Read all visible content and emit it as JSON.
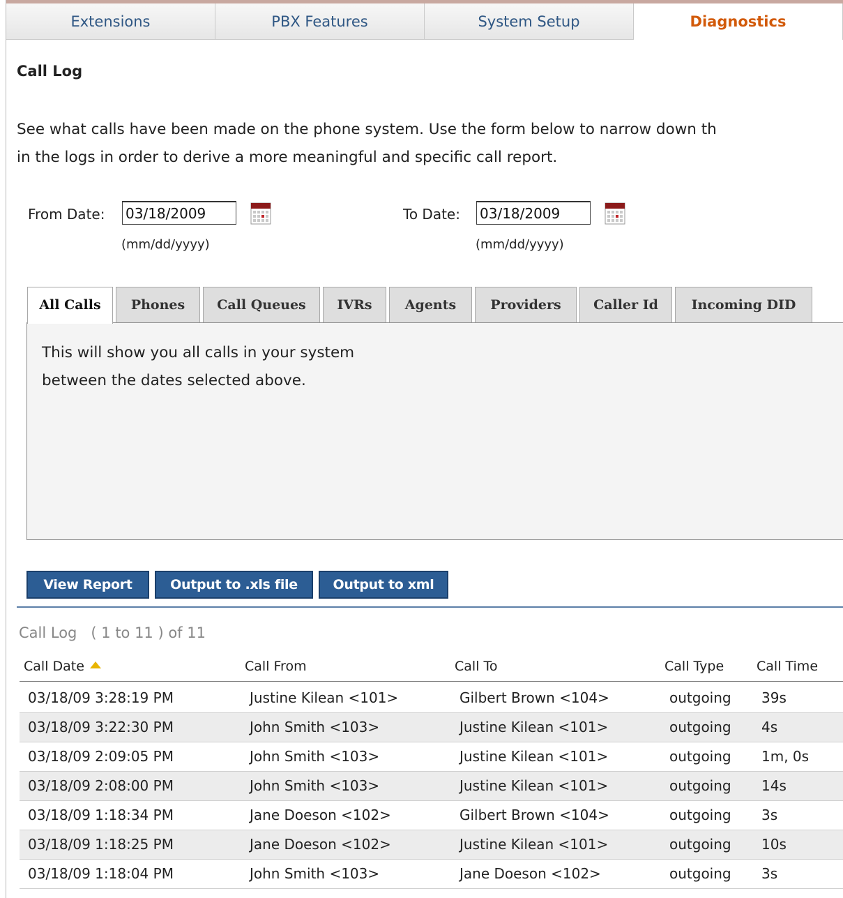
{
  "nav": {
    "tabs": [
      {
        "label": "Extensions"
      },
      {
        "label": "PBX Features"
      },
      {
        "label": "System Setup"
      },
      {
        "label": "Diagnostics"
      }
    ]
  },
  "page": {
    "title": "Call Log",
    "intro_line1": "See what calls have been made on the phone system. Use the form below to narrow down th",
    "intro_line2": "in the logs in order to derive a more meaningful and specific call report."
  },
  "dates": {
    "from_label": "From Date:",
    "from_value": "03/18/2009",
    "to_label": "To Date:",
    "to_value": "03/18/2009",
    "format_hint": "(mm/dd/yyyy)"
  },
  "filter": {
    "tabs": [
      "All Calls",
      "Phones",
      "Call Queues",
      "IVRs",
      "Agents",
      "Providers",
      "Caller Id",
      "Incoming DID"
    ],
    "description_line1": "This will show you all calls in your system",
    "description_line2": "between the dates selected above."
  },
  "buttons": {
    "view_report": "View Report",
    "output_xls": "Output to .xls file",
    "output_xml": "Output to xml"
  },
  "log": {
    "title": "Call Log   ( 1 to 11 ) of 11",
    "columns": [
      "Call Date",
      "Call From",
      "Call To",
      "Call Type",
      "Call Time"
    ],
    "rows": [
      [
        "03/18/09 3:28:19 PM",
        "Justine Kilean <101>",
        "Gilbert Brown <104>",
        "outgoing",
        "39s"
      ],
      [
        "03/18/09 3:22:30 PM",
        "John Smith <103>",
        "Justine Kilean <101>",
        "outgoing",
        "4s"
      ],
      [
        "03/18/09 2:09:05 PM",
        "John Smith <103>",
        "Justine Kilean <101>",
        "outgoing",
        "1m, 0s"
      ],
      [
        "03/18/09 2:08:00 PM",
        "John Smith <103>",
        "Justine Kilean <101>",
        "outgoing",
        "14s"
      ],
      [
        "03/18/09 1:18:34 PM",
        "Jane Doeson <102>",
        "Gilbert Brown <104>",
        "outgoing",
        "3s"
      ],
      [
        "03/18/09 1:18:25 PM",
        "Jane Doeson <102>",
        "Justine Kilean <101>",
        "outgoing",
        "10s"
      ],
      [
        "03/18/09 1:18:04 PM",
        "John Smith <103>",
        "Jane Doeson <102>",
        "outgoing",
        "3s"
      ]
    ]
  },
  "colors": {
    "nav_text": "#2f5784",
    "nav_active": "#d25a0a",
    "button_bg": "#2c5d94",
    "sort_arrow": "#e8b400"
  },
  "icons": {
    "calendar": "calendar-icon",
    "sort": "sort-ascending-icon"
  }
}
